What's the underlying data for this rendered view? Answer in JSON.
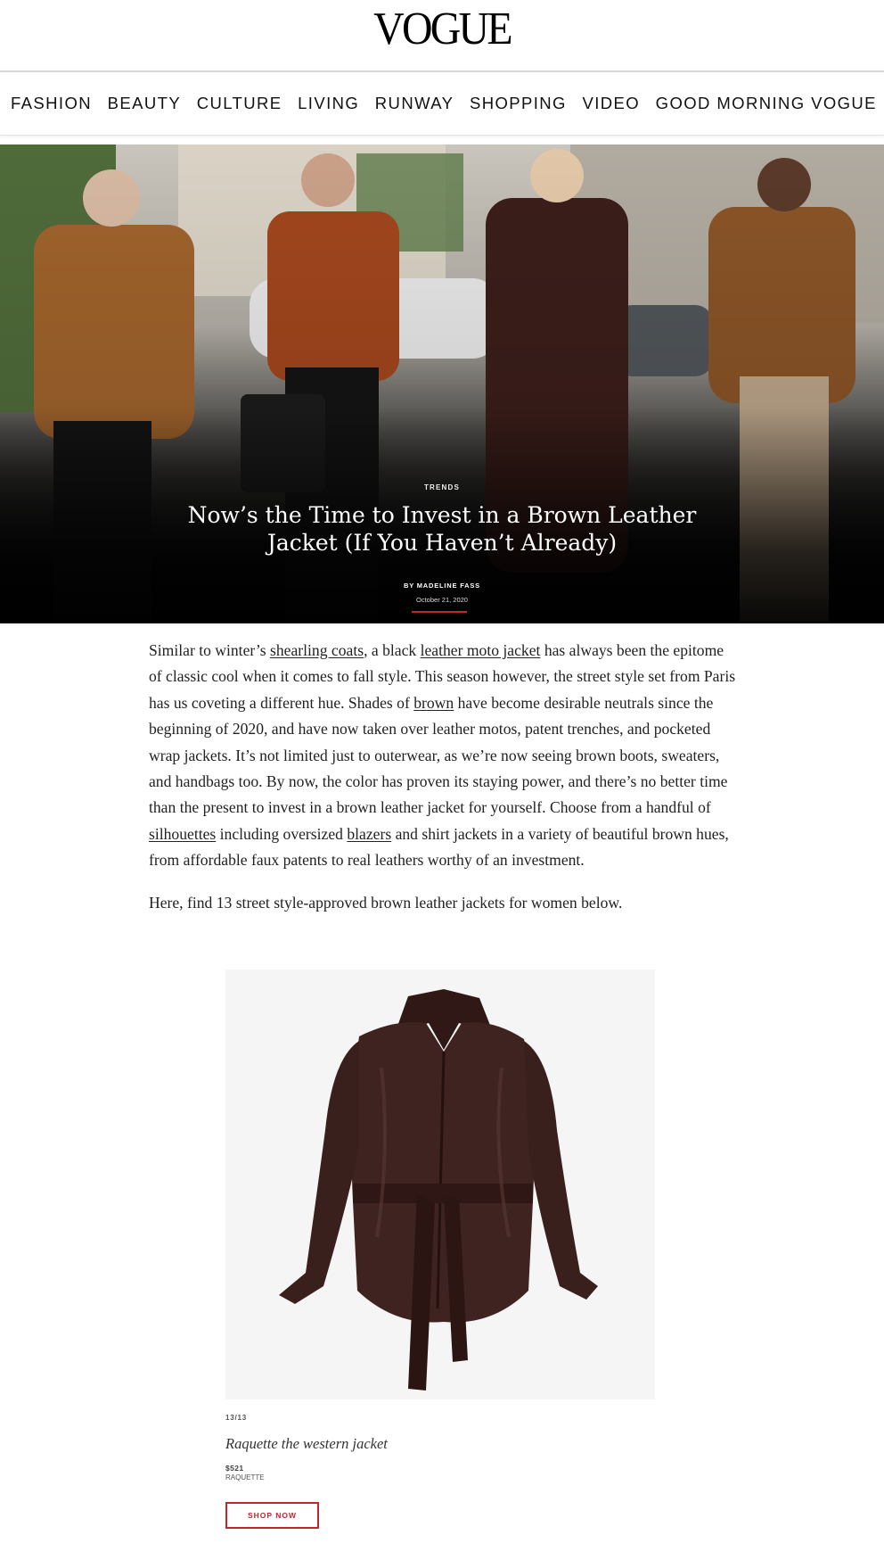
{
  "header": {
    "logo": "VOGUE"
  },
  "nav": {
    "items": [
      "FASHION",
      "BEAUTY",
      "CULTURE",
      "LIVING",
      "RUNWAY",
      "SHOPPING",
      "VIDEO",
      "GOOD MORNING VOGUE"
    ]
  },
  "hero": {
    "kicker": "TRENDS",
    "headline": "Now’s the Time to Invest in a Brown Leather Jacket (If You Haven’t Already)",
    "byline": "BY MADELINE FASS",
    "date": "October 21, 2020"
  },
  "article": {
    "p1": [
      "Similar to winter’s ",
      "shearling coats",
      ", a black ",
      "leather moto jacket",
      " has always been the epitome of classic cool when it comes to fall style. This season however, the street style set from Paris has us coveting a different hue. Shades of ",
      "brown",
      " have become desirable neutrals since the beginning of 2020, and have now taken over leather motos, patent trenches, and pocketed wrap jackets. It’s not limited just to outerwear, as we’re now seeing brown boots, sweaters, and handbags too. By now, the color has proven its staying power, and there’s no better time than the present to invest in a brown leather jacket for yourself. Choose from a handful of ",
      "silhouettes",
      " including oversized ",
      "blazers",
      " and shirt jackets in a variety of beautiful brown hues, from affordable faux patents to real leathers worthy of an investment."
    ],
    "p2": "Here, find 13 street style-approved brown leather jackets for women below."
  },
  "product": {
    "counter": "13/13",
    "name": "Raquette the western jacket",
    "price": "$521",
    "brand": "RAQUETTE",
    "cta": "SHOP NOW"
  },
  "colors": {
    "accent": "#c4242b",
    "jacket": "#3e2320"
  }
}
